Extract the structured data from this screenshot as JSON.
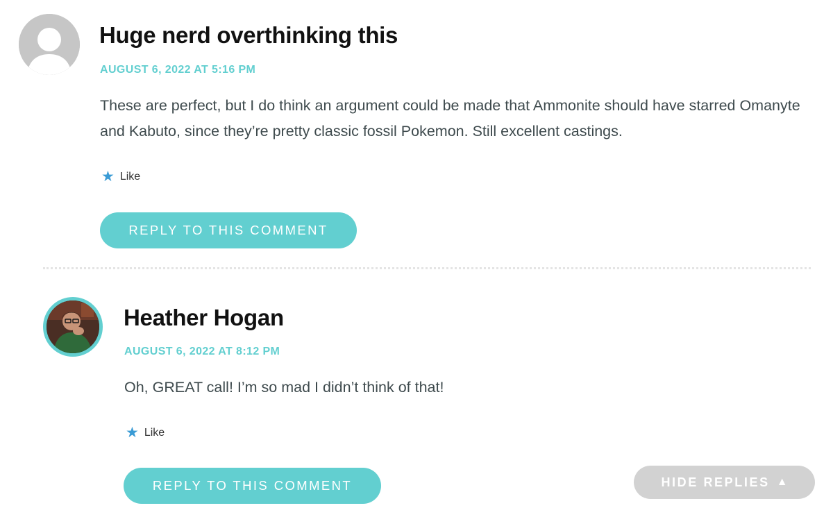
{
  "comments": [
    {
      "author": "Huge nerd overthinking this",
      "date": "AUGUST 6, 2022 AT 5:16 PM",
      "body": "These are perfect, but I do think an argument could be made that Ammonite should have starred Omanyte and Kabuto, since they’re pretty classic fossil Pokemon. Still excellent castings.",
      "like_label": "Like",
      "reply_label": "REPLY TO THIS COMMENT",
      "avatar": "default-avatar"
    },
    {
      "author": "Heather Hogan",
      "date": "AUGUST 6, 2022 AT 8:12 PM",
      "body": "Oh, GREAT call! I’m so mad I didn’t think of that!",
      "like_label": "Like",
      "reply_label": "REPLY TO THIS COMMENT",
      "avatar": "user-photo"
    }
  ],
  "hide_replies": {
    "label": "HIDE REPLIES",
    "icon": "triangle-up-icon"
  },
  "colors": {
    "accent": "#62cfd0",
    "star": "#3a9bd5",
    "hide_button": "#d2d2d2",
    "author": "#111111",
    "body_text": "#3e4a4d"
  }
}
